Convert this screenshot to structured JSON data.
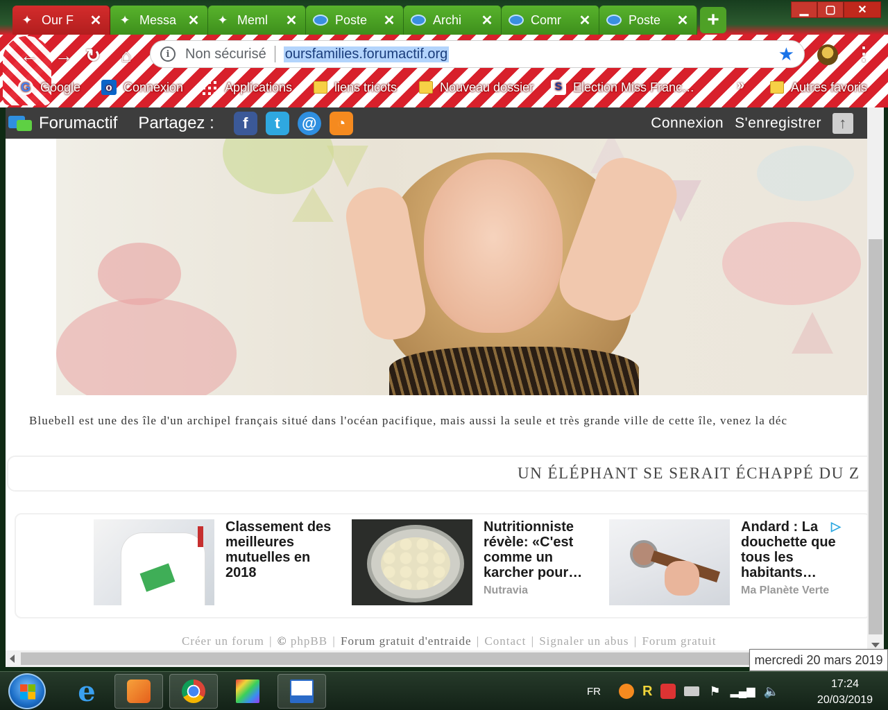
{
  "browser": {
    "tabs": [
      {
        "title": "Our F",
        "icon": "forum-icon",
        "active": true
      },
      {
        "title": "Messa",
        "icon": "forum-icon"
      },
      {
        "title": "Meml",
        "icon": "forum-icon"
      },
      {
        "title": "Poste",
        "icon": "chat-bubble-icon"
      },
      {
        "title": "Archi",
        "icon": "chat-bubble-icon"
      },
      {
        "title": "Comr",
        "icon": "chat-bubble-icon"
      },
      {
        "title": "Poste",
        "icon": "chat-bubble-icon"
      }
    ],
    "security_label": "Non sécurisé",
    "url": "oursfamilies.forumactif.org",
    "bookmarks": [
      "Google",
      "Connexion",
      "Applications",
      "liens tricots",
      "Nouveau dossier",
      "Election Miss Franc…"
    ],
    "other_bookmarks": "Autres favoris",
    "more_symbol": "»"
  },
  "forum_bar": {
    "brand": "Forumactif",
    "share_label": "Partagez :",
    "login": "Connexion",
    "register": "S'enregistrer"
  },
  "page": {
    "description": "Bluebell est une des île d'un archipel français situé dans l'océan pacifique, mais aussi la seule et très grande ville de cette île, venez la déc",
    "news_headline": "UN ÉLÉPHANT SE SERAIT ÉCHAPPÉ DU Z"
  },
  "ads": [
    {
      "title": "Classement des meilleures mutuelles en 2018",
      "source": ""
    },
    {
      "title": "Nutritionniste révèle: «C'est comme un karcher pour…",
      "source": "Nutravia"
    },
    {
      "title": "Andard : La douchette que tous les habitants…",
      "source": "Ma Planète Verte"
    }
  ],
  "footer": {
    "create": "Créer un forum",
    "copyright": "©",
    "phpbb": "phpBB",
    "free_help": "Forum gratuit d'entraide",
    "contact": "Contact",
    "report": "Signaler un abus",
    "free": "Forum gratuit"
  },
  "tooltip": "mercredi 20 mars 2019",
  "taskbar": {
    "language": "FR",
    "time": "17:24",
    "date": "20/03/2019"
  },
  "colors": {
    "tab_green": "#4ea126",
    "tab_red": "#c42424",
    "forum_bar": "#3d3d3d",
    "url_selection": "#b3d4fc"
  }
}
